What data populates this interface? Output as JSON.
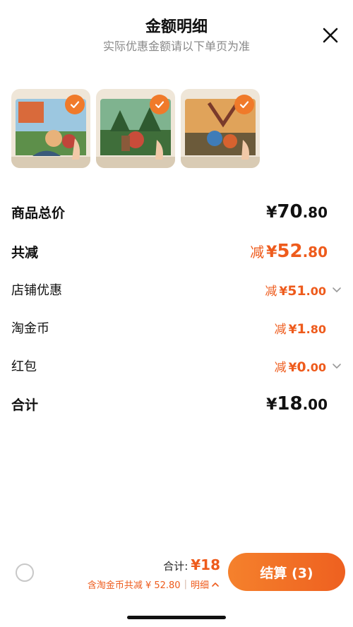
{
  "header": {
    "title": "金额明细",
    "subtitle": "实际优惠金额请以下单页为准"
  },
  "products": [
    {
      "alt": "龟兔赛跑",
      "checked": true,
      "colors": {
        "sky": "#9cc7e0",
        "ground": "#5d8f4a",
        "accent": "#d96a3b"
      }
    },
    {
      "alt": "小王子",
      "checked": true,
      "colors": {
        "sky": "#7fb38f",
        "ground": "#3f6e3a",
        "accent": "#c94c3a"
      }
    },
    {
      "alt": "拉卜王子",
      "checked": true,
      "colors": {
        "sky": "#e0a35a",
        "ground": "#6b5a3a",
        "accent": "#3f7cb8"
      }
    }
  ],
  "summary": {
    "goods_total": {
      "label": "商品总价",
      "currency": "¥",
      "int": "70",
      "dec": ".80"
    },
    "total_reduce": {
      "label": "共减",
      "prefix": "减",
      "currency": "¥",
      "int": "52",
      "dec": ".80"
    },
    "shop_discount": {
      "label": "店铺优惠",
      "prefix": "减",
      "currency": "¥",
      "int": "51",
      "dec": ".00"
    },
    "taojinbi": {
      "label": "淘金币",
      "prefix": "减",
      "currency": "¥",
      "int": "1",
      "dec": ".80"
    },
    "red_packet": {
      "label": "红包",
      "prefix": "减",
      "currency": "¥",
      "int": "0",
      "dec": ".00"
    },
    "grand_total": {
      "label": "合计",
      "currency": "¥",
      "int": "18",
      "dec": ".00"
    }
  },
  "footer": {
    "total_label": "合计:",
    "total_value": "¥18",
    "sub_text": "含淘金币共减 ¥ 52.80",
    "detail_label": "明细",
    "checkout_label": "结算 (3)"
  },
  "colors": {
    "accent": "#ee5b1c",
    "button": "#f07a2a"
  }
}
